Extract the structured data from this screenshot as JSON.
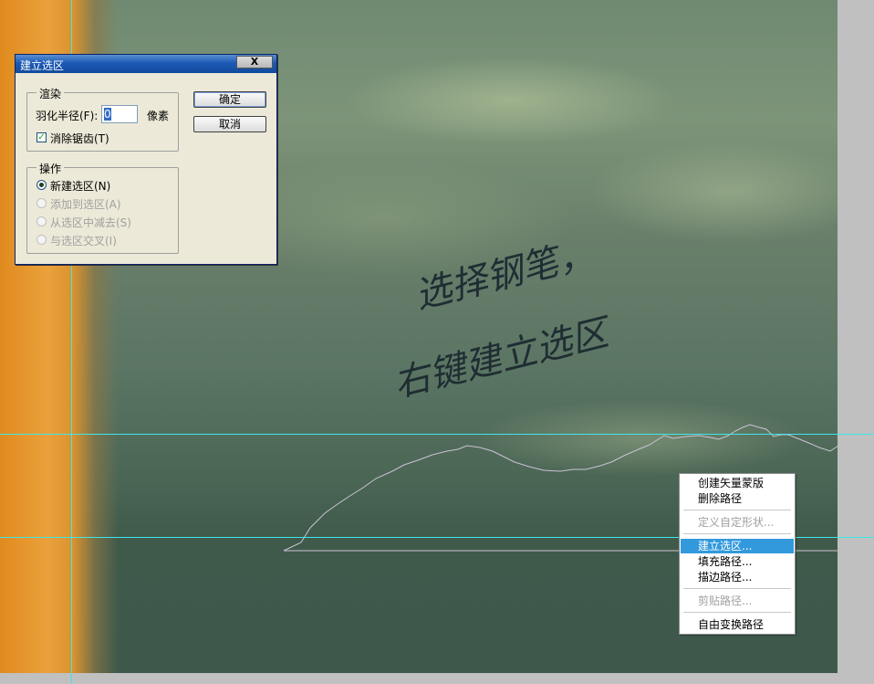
{
  "dialog": {
    "title": "建立选区",
    "close_label": "X",
    "render_group": {
      "legend": "渲染",
      "feather_label": "羽化半径(F):",
      "feather_value": "0",
      "feather_unit": "像素",
      "antialias_label": "消除锯齿(T)",
      "antialias_checked": true
    },
    "operation_group": {
      "legend": "操作",
      "options": [
        {
          "label": "新建选区(N)",
          "selected": true,
          "enabled": true
        },
        {
          "label": "添加到选区(A)",
          "selected": false,
          "enabled": false
        },
        {
          "label": "从选区中减去(S)",
          "selected": false,
          "enabled": false
        },
        {
          "label": "与选区交叉(I)",
          "selected": false,
          "enabled": false
        }
      ]
    },
    "ok_label": "确定",
    "cancel_label": "取消"
  },
  "context_menu": {
    "items": [
      {
        "label": "创建矢量蒙版",
        "enabled": true,
        "highlighted": false
      },
      {
        "label": "删除路径",
        "enabled": true,
        "highlighted": false
      },
      {
        "label": "定义自定形状...",
        "enabled": false,
        "highlighted": false
      },
      {
        "label": "建立选区...",
        "enabled": true,
        "highlighted": true
      },
      {
        "label": "填充路径...",
        "enabled": true,
        "highlighted": false
      },
      {
        "label": "描边路径...",
        "enabled": true,
        "highlighted": false
      },
      {
        "label": "剪贴路径...",
        "enabled": false,
        "highlighted": false
      },
      {
        "label": "自由变换路径",
        "enabled": true,
        "highlighted": false
      }
    ]
  },
  "annotation": {
    "line1": "选择钢笔，",
    "line2": "右键建立选区"
  },
  "colors": {
    "guide": "#3fe6ea",
    "menu_highlight": "#3399dd",
    "titlebar": "#1c5ab6"
  }
}
